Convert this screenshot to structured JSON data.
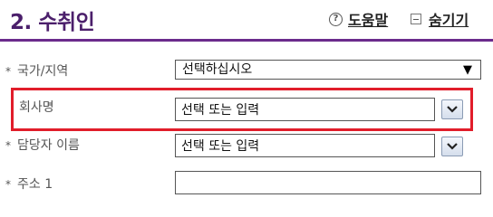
{
  "header": {
    "title_number": "2.",
    "title_text": "수취인",
    "help_icon": "?",
    "help_label": "도움말",
    "hide_label": "숨기기"
  },
  "form": {
    "country": {
      "required_mark": "*",
      "label": "국가/지역",
      "value": "선택하십시오",
      "arrow": "▼"
    },
    "company": {
      "label": "회사명",
      "value": "선택 또는 입력"
    },
    "contact": {
      "required_mark": "*",
      "label": "담당자 이름",
      "value": "선택 또는 입력"
    },
    "address1": {
      "required_mark": "*",
      "label": "주소 1",
      "value": ""
    }
  },
  "colors": {
    "header_rule": "#6b2b8c",
    "title": "#4b1f6b",
    "highlight": "#e11d2a"
  }
}
